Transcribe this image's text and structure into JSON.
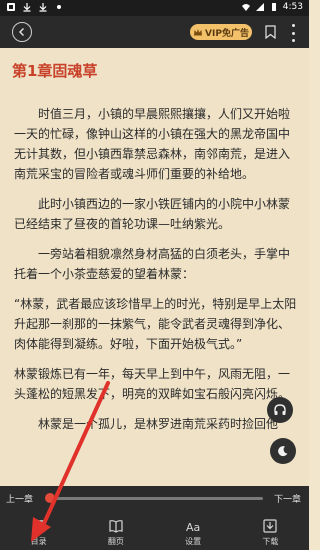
{
  "status": {
    "time": "4:53"
  },
  "topbar": {
    "vip_label": "VIP免广告"
  },
  "reader": {
    "chapter_title": "第1章固魂草",
    "paragraphs": [
      "时值三月，小镇的早晨熙熙攘攘，人们又开始啦一天的忙碌，像钟山这样的小镇在强大的黑龙帝国中无计其数，但小镇西靠禁忌森林，南邻南荒，是进入南荒采宝的冒险者或魂斗师们重要的补给地。",
      "此时小镇西边的一家小铁匠铺内的小院中小林蒙已经结束了昼夜的首轮功课—吐纳紫光。",
      "一旁站着相貌凛然身材高猛的白须老头，手掌中托着一个小茶壶慈爱的望着林蒙：",
      "“林蒙，武者最应该珍惜早上的时光，特别是早上太阳升起那一刹那的一抹紫气，能令武者灵魂得到净化、肉体能得到凝练。好啦，下面开始极气式。”",
      "林蒙锻炼已有一年，每天早上到中午，风雨无阻，一头蓬松的短黑发下，明亮的双眸如宝石般闪亮闪烁。",
      "林蒙是一个孤儿，是林罗进南荒采药时捡回他"
    ]
  },
  "bottombar": {
    "prev_label": "上一章",
    "next_label": "下一章",
    "progress": 0.0,
    "menu": [
      {
        "label": "目录",
        "icon": "catalog-icon"
      },
      {
        "label": "翻页",
        "icon": "page-turn-icon"
      },
      {
        "label": "设置",
        "icon": "font-settings-icon"
      },
      {
        "label": "下载",
        "icon": "download-icon"
      }
    ]
  },
  "colors": {
    "accent": "#e34a3a",
    "title": "#c8422a",
    "vip": "#f3c16a",
    "paper": "#efe2c7",
    "bar": "#2b2b2b"
  }
}
